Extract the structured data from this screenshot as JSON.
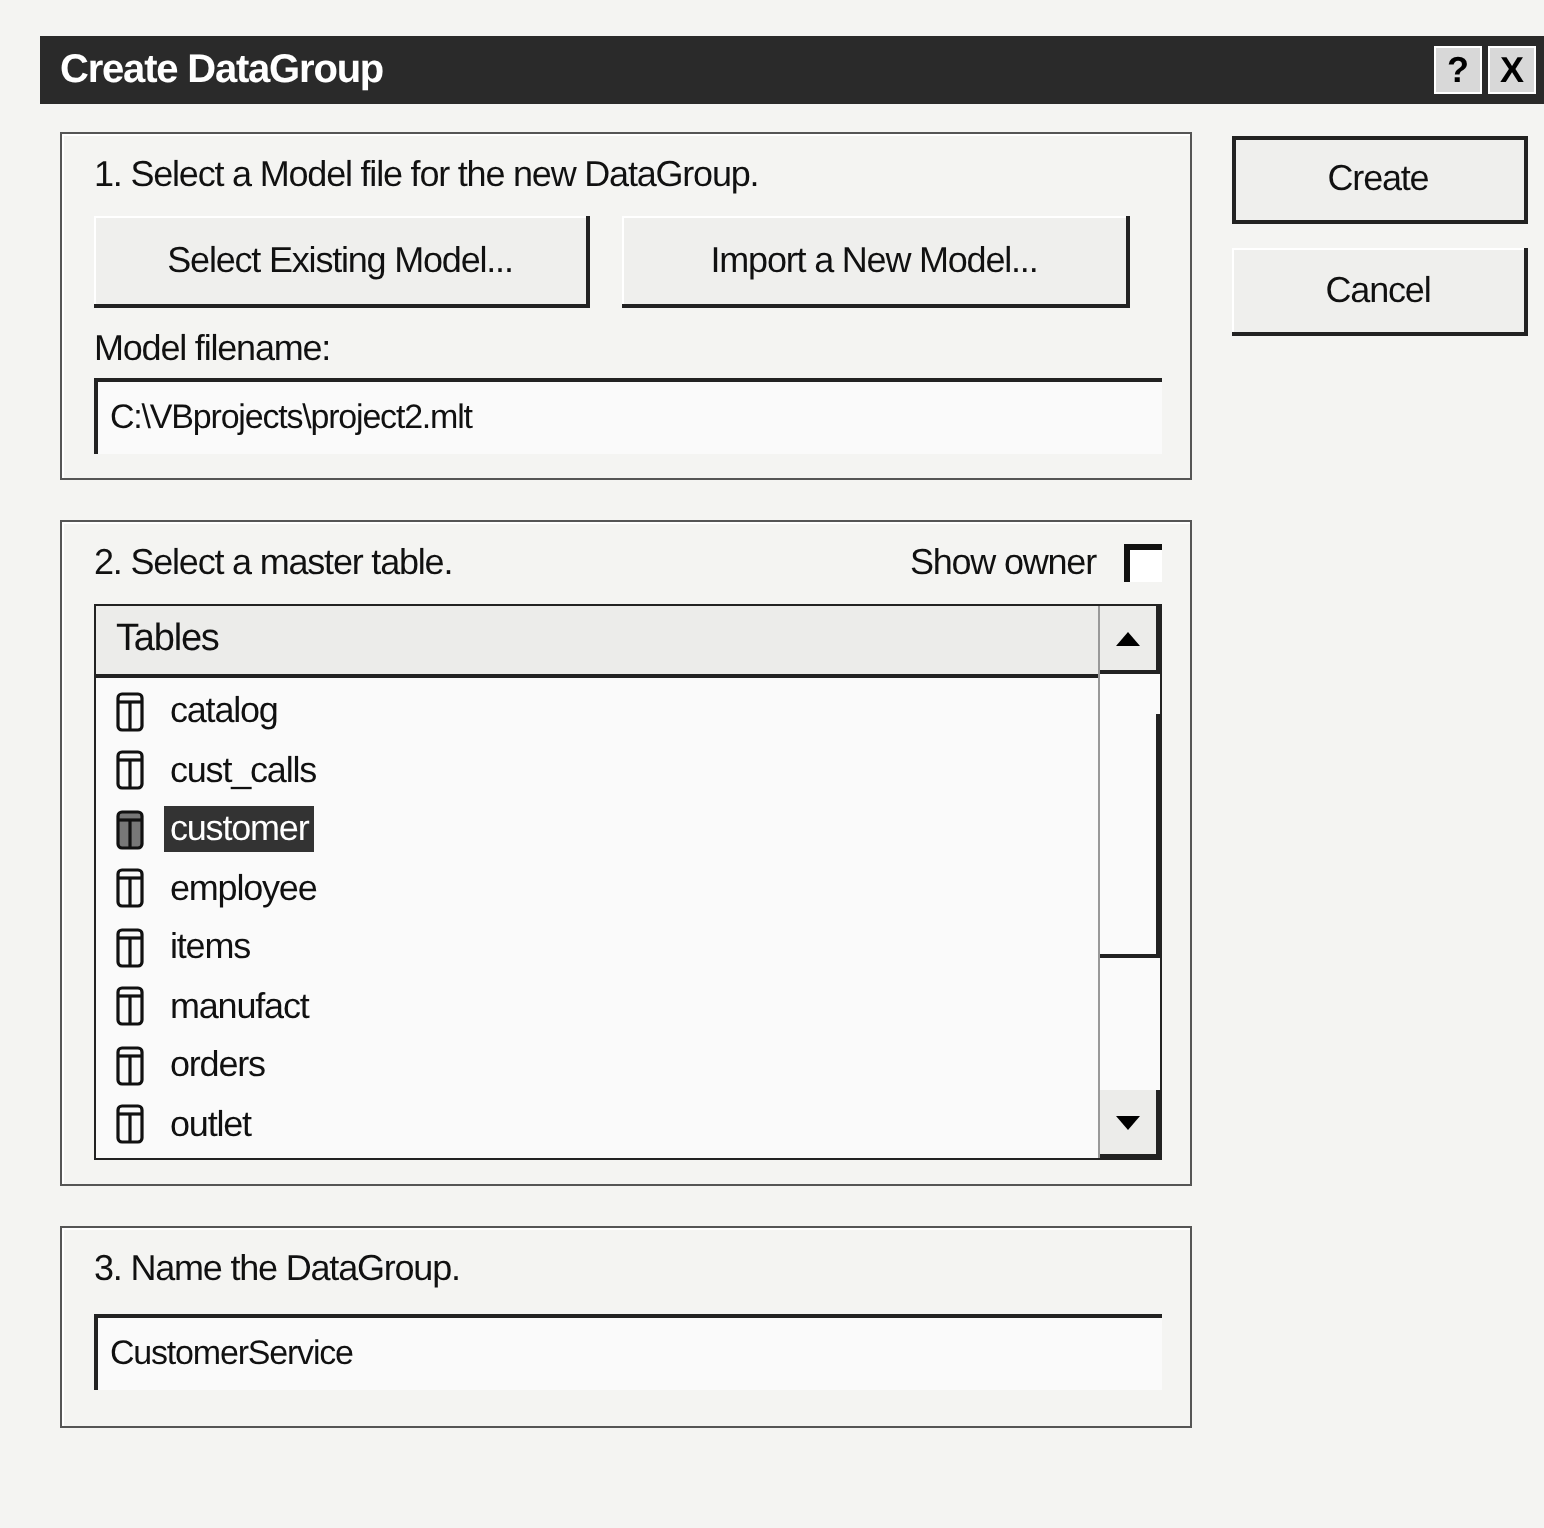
{
  "window": {
    "title": "Create DataGroup",
    "title_buttons": [
      "?",
      "X"
    ]
  },
  "model_section": {
    "heading": "1. Select a Model file for the new DataGroup.",
    "buttons": [
      "Select Existing Model...",
      "Import a New Model..."
    ],
    "filename_label": "Model filename:",
    "filename_value": "C:\\VBprojects\\project2.mlt"
  },
  "dialog_buttons": [
    {
      "label": "Create",
      "default": true
    },
    {
      "label": "Cancel",
      "default": false
    }
  ],
  "table_section": {
    "heading": "2. Select a master table.",
    "show_owner": {
      "label": "Show owner",
      "checked": false
    },
    "column": "Tables",
    "rows": [
      {
        "name": "catalog",
        "selected": false
      },
      {
        "name": "cust_calls",
        "selected": false
      },
      {
        "name": "customer",
        "selected": true
      },
      {
        "name": "employee",
        "selected": false
      },
      {
        "name": "items",
        "selected": false
      },
      {
        "name": "manufact",
        "selected": false
      },
      {
        "name": "orders",
        "selected": false
      },
      {
        "name": "outlet",
        "selected": false
      }
    ]
  },
  "name_section": {
    "heading": "3. Name the DataGroup.",
    "value": "CustomerService"
  }
}
